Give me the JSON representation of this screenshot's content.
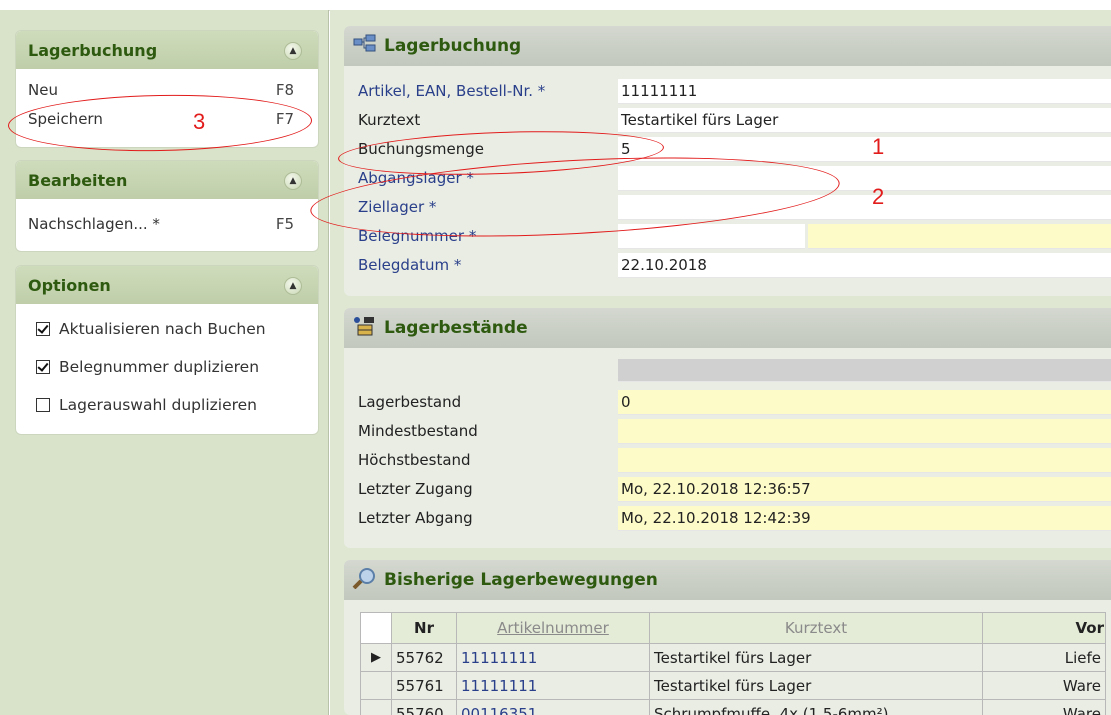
{
  "sidebar": {
    "booking_panel": {
      "title": "Lagerbuchung",
      "items": [
        {
          "label": "Neu",
          "key": "F8"
        },
        {
          "label": "Speichern",
          "key": "F7"
        }
      ]
    },
    "edit_panel": {
      "title": "Bearbeiten",
      "items": [
        {
          "label": "Nachschlagen... *",
          "key": "F5"
        }
      ]
    },
    "options_panel": {
      "title": "Optionen",
      "options": [
        {
          "label": "Aktualisieren nach Buchen",
          "checked": true
        },
        {
          "label": "Belegnummer duplizieren",
          "checked": true
        },
        {
          "label": "Lagerauswahl duplizieren",
          "checked": false
        }
      ]
    }
  },
  "booking": {
    "title": "Lagerbuchung",
    "fields": {
      "artikel": {
        "label": "Artikel, EAN, Bestell-Nr. *",
        "value": "11111111"
      },
      "kurztext": {
        "label": "Kurztext",
        "value": "Testartikel fürs Lager"
      },
      "menge": {
        "label": "Buchungsmenge",
        "value": "5"
      },
      "abgangslager": {
        "label": "Abgangslager *",
        "value": ""
      },
      "ziellager": {
        "label": "Ziellager *",
        "value": ""
      },
      "belegnummer": {
        "label": "Belegnummer *",
        "value": ""
      },
      "belegdatum": {
        "label": "Belegdatum *",
        "value": "22.10.2018"
      }
    }
  },
  "stock": {
    "title": "Lagerbestände",
    "rows": [
      {
        "label": "Lagerbestand",
        "value": "0"
      },
      {
        "label": "Mindestbestand",
        "value": ""
      },
      {
        "label": "Höchstbestand",
        "value": ""
      },
      {
        "label": "Letzter Zugang",
        "value": "Mo, 22.10.2018 12:36:57"
      },
      {
        "label": "Letzter Abgang",
        "value": "Mo, 22.10.2018 12:42:39"
      }
    ]
  },
  "movements": {
    "title": "Bisherige Lagerbewegungen",
    "columns": [
      "Nr",
      "Artikelnummer",
      "Kurztext",
      "Vor"
    ],
    "rows": [
      {
        "nr": "55762",
        "artikel": "11111111",
        "kurztext": "Testartikel fürs Lager",
        "vor": "Liefe"
      },
      {
        "nr": "55761",
        "artikel": "11111111",
        "kurztext": "Testartikel fürs Lager",
        "vor": "Ware"
      },
      {
        "nr": "55760",
        "artikel": "00116351",
        "kurztext": "Schrumpfmuffe, 4x (1,5-6mm²)",
        "vor": "Ware"
      }
    ]
  },
  "annotations": {
    "one": "1",
    "two": "2",
    "three": "3"
  },
  "colors": {
    "annotation": "#e21b1b",
    "header_text": "#2e5a10",
    "highlight": "#fdfbc8"
  }
}
